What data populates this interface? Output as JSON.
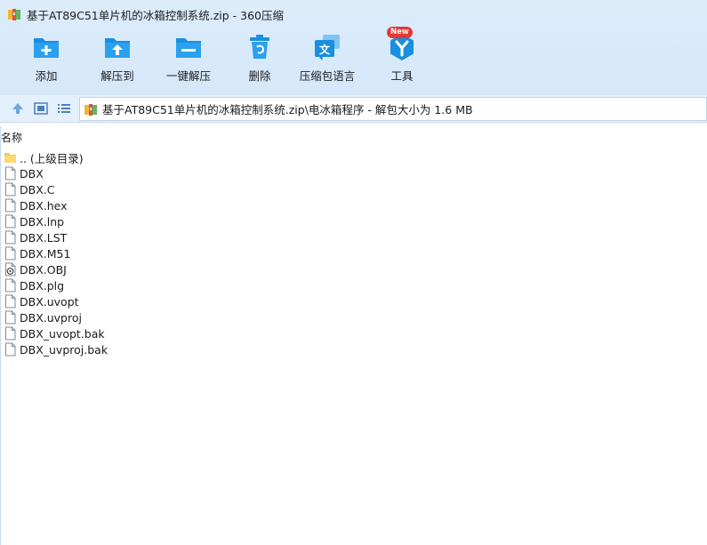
{
  "window": {
    "title": "基于AT89C51单片机的冰箱控制系统.zip - 360压缩"
  },
  "toolbar": {
    "add_label": "添加",
    "extract_to_label": "解压到",
    "one_click_extract_label": "一键解压",
    "delete_label": "删除",
    "language_pack_label": "压缩包语言",
    "tools_label": "工具",
    "tools_badge": "New"
  },
  "address": {
    "path": "基于AT89C51单片机的冰箱控制系统.zip\\电冰箱程序 - 解包大小为 1.6 MB"
  },
  "list": {
    "column_name": "名称",
    "items": [
      {
        "name": ".. (上级目录)",
        "icon": "folder-icon"
      },
      {
        "name": "DBX",
        "icon": "file-icon"
      },
      {
        "name": "DBX.C",
        "icon": "file-icon"
      },
      {
        "name": "DBX.hex",
        "icon": "file-icon"
      },
      {
        "name": "DBX.lnp",
        "icon": "file-icon"
      },
      {
        "name": "DBX.LST",
        "icon": "file-icon"
      },
      {
        "name": "DBX.M51",
        "icon": "file-icon"
      },
      {
        "name": "DBX.OBJ",
        "icon": "obj-file-icon"
      },
      {
        "name": "DBX.plg",
        "icon": "file-icon"
      },
      {
        "name": "DBX.uvopt",
        "icon": "file-icon"
      },
      {
        "name": "DBX.uvproj",
        "icon": "file-icon"
      },
      {
        "name": "DBX_uvopt.bak",
        "icon": "file-icon"
      },
      {
        "name": "DBX_uvproj.bak",
        "icon": "file-icon"
      }
    ]
  },
  "colors": {
    "accent": "#1a8fe0",
    "chrome_bg": "#d8eafb",
    "badge": "#e53935"
  }
}
